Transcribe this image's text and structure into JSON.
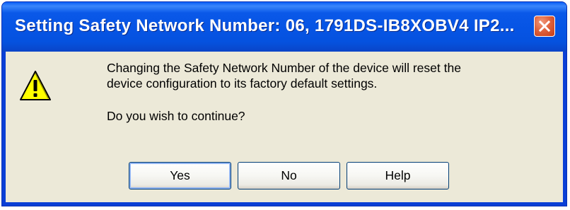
{
  "window": {
    "title": "Setting Safety Network Number: 06, 1791DS-IB8XOBV4 IP2..."
  },
  "icons": {
    "warning": "warning-triangle-icon",
    "close": "close-x-icon"
  },
  "message": {
    "line1": "Changing the Safety Network Number of the device will reset the",
    "line2": "device configuration to its factory default settings.",
    "question": "Do you wish to continue?"
  },
  "buttons": {
    "yes": "Yes",
    "no": "No",
    "help": "Help"
  },
  "colors": {
    "titlebar": "#0654e4",
    "dialog_background": "#ece9d8",
    "close_button": "#e0633d",
    "warning_fill": "#ffff00"
  }
}
